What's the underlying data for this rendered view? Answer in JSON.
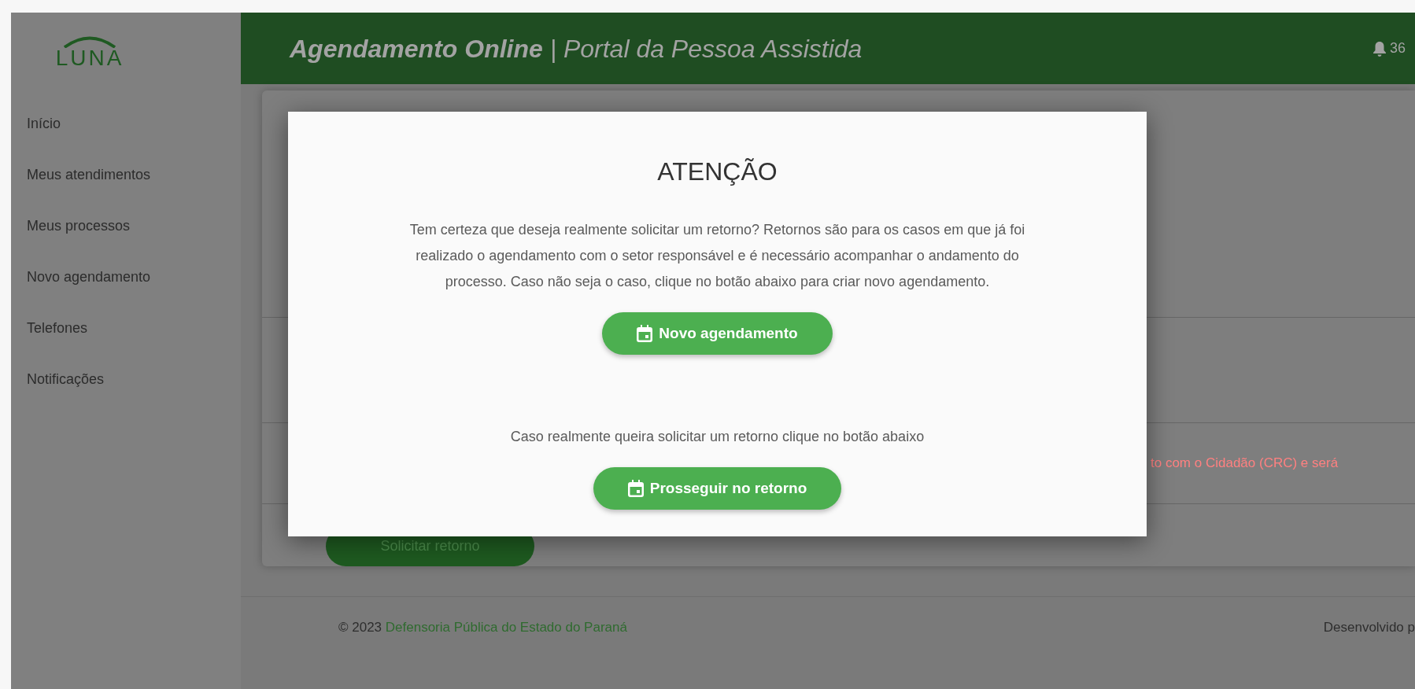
{
  "sidebar": {
    "logo": "LUNA",
    "items": [
      {
        "label": "Início"
      },
      {
        "label": "Meus atendimentos"
      },
      {
        "label": "Meus processos"
      },
      {
        "label": "Novo agendamento"
      },
      {
        "label": "Telefones"
      },
      {
        "label": "Notificações"
      }
    ]
  },
  "header": {
    "title": "**Agendamento Online** | Portal da Pessoa Assistida",
    "notifications": "36"
  },
  "background": {
    "notice": "to com o Cidadão (CRC) e será",
    "button": "Solicitar retorno"
  },
  "footer": {
    "copyright": "© 2023",
    "link": "Defensoria Pública do Estado do Paraná",
    "credit": "Desenvolvido p"
  },
  "modal": {
    "title": "ATENÇÃO",
    "message": "Tem certeza que deseja realmente solicitar um retorno? Retornos são para os casos em que já foi realizado o agendamento com o setor responsável e é necessário acompanhar o andamento do processo. Caso não seja o caso, clique no botão abaixo para criar novo agendamento.",
    "primary_button": "Novo agendamento",
    "note": "Caso realmente queira solicitar um retorno clique no botão abaixo",
    "secondary_button": "Prosseguir no retorno"
  }
}
